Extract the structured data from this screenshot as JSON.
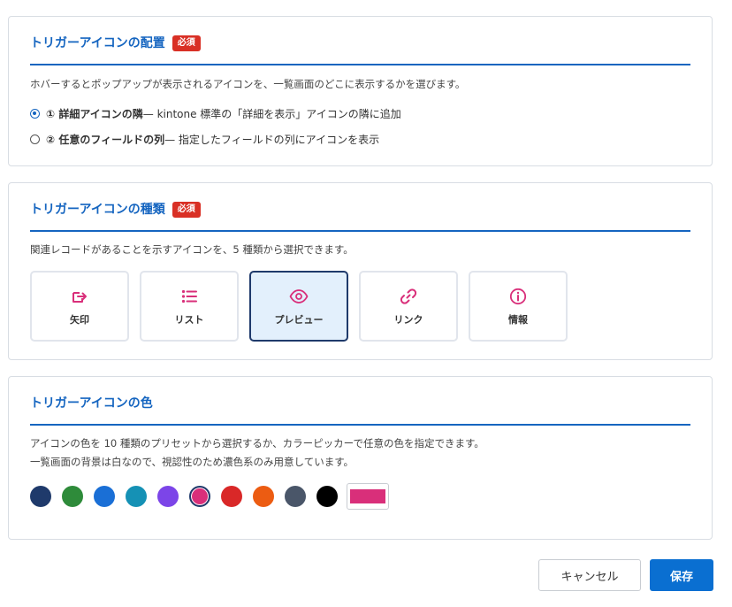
{
  "placement": {
    "title": "トリガーアイコンの配置",
    "badge": "必須",
    "description": "ホバーするとポップアップが表示されるアイコンを、一覧画面のどこに表示するかを選びます。",
    "options": [
      {
        "label": "① 詳細アイコンの隣",
        "detail": " — kintone 標準の「詳細を表示」アイコンの隣に追加",
        "checked": true
      },
      {
        "label": "② 任意のフィールドの列",
        "detail": " — 指定したフィールドの列にアイコンを表示",
        "checked": false
      }
    ]
  },
  "icon_type": {
    "title": "トリガーアイコンの種類",
    "badge": "必須",
    "description": "関連レコードがあることを示すアイコンを、5 種類から選択できます。",
    "items": [
      {
        "label": "矢印",
        "icon": "arrow-icon"
      },
      {
        "label": "リスト",
        "icon": "list-icon"
      },
      {
        "label": "プレビュー",
        "icon": "eye-icon",
        "selected": true
      },
      {
        "label": "リンク",
        "icon": "link-icon"
      },
      {
        "label": "情報",
        "icon": "info-icon"
      }
    ]
  },
  "icon_color": {
    "title": "トリガーアイコンの色",
    "description_line1": "アイコンの色を 10 種類のプリセットから選択するか、カラーピッカーで任意の色を指定できます。",
    "description_line2": "一覧画面の背景は白なので、視認性のため濃色系のみ用意しています。",
    "presets": [
      "#1f3a6b",
      "#2e8b3a",
      "#1a6fd6",
      "#1591b5",
      "#7c45e8",
      "#d92f7a",
      "#d92828",
      "#ec5c12",
      "#4a5669",
      "#000000"
    ],
    "selected_color": "#d92f7a",
    "picker_color": "#d92f7a"
  },
  "accent_color": "#1565c0",
  "icon_accent": "#d92f7a",
  "buttons": {
    "cancel": "キャンセル",
    "save": "保存"
  }
}
